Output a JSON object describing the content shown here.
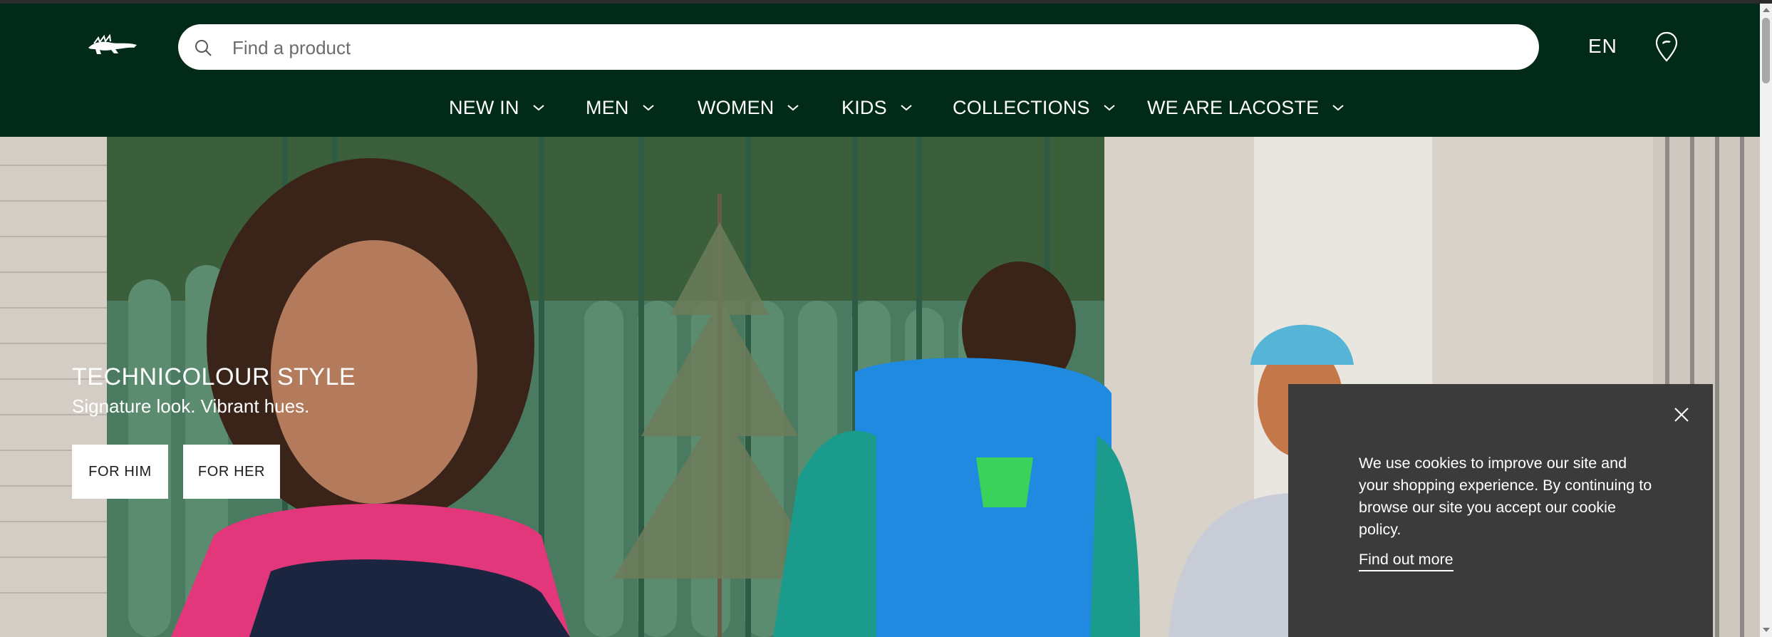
{
  "header": {
    "logo_name": "lacoste-crocodile-logo",
    "search": {
      "placeholder": "Find a product",
      "value": ""
    },
    "language": "EN",
    "store_locator_icon": "location-pin-icon",
    "nav": [
      {
        "label": "NEW IN"
      },
      {
        "label": "MEN"
      },
      {
        "label": "WOMEN"
      },
      {
        "label": "KIDS"
      },
      {
        "label": "COLLECTIONS"
      },
      {
        "label": "WE ARE LACOSTE"
      }
    ]
  },
  "hero": {
    "title": "TECHNICOLOUR STYLE",
    "subtitle": "Signature look. Vibrant hues.",
    "buttons": [
      {
        "label": "FOR HIM"
      },
      {
        "label": "FOR HER"
      }
    ]
  },
  "cookie_banner": {
    "text": "We use cookies to improve our site and your shopping experience. By continuing to browse our site you accept our cookie policy.",
    "link": "Find out more",
    "close_icon": "close-icon"
  },
  "colors": {
    "header_bg": "#012a18",
    "cookie_bg": "#3b3b3b",
    "button_bg": "#ffffff"
  }
}
